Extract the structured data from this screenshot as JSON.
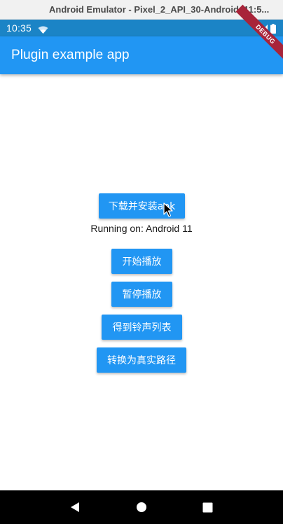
{
  "window": {
    "title": "Android Emulator - Pixel_2_API_30-Android_11:5..."
  },
  "status_bar": {
    "time": "10:35",
    "icons": [
      "wifi-icon",
      "signal-icon",
      "battery-icon"
    ]
  },
  "app_bar": {
    "title": "Plugin example app",
    "color": "#2196f3"
  },
  "debug_banner": "DEBUG",
  "main": {
    "download_button": "下载并安装apk",
    "running_text": "Running on: Android 11",
    "start_button": "开始播放",
    "pause_button": "暂停播放",
    "ringtone_button": "得到铃声列表",
    "path_button": "转换为真实路径"
  },
  "nav_bar": {
    "icons": [
      "back-icon",
      "home-icon",
      "recents-icon"
    ]
  },
  "colors": {
    "accent": "#2196f3",
    "status_bar": "#1b84c6",
    "nav_bar": "#000000",
    "debug": "#a8243a"
  }
}
